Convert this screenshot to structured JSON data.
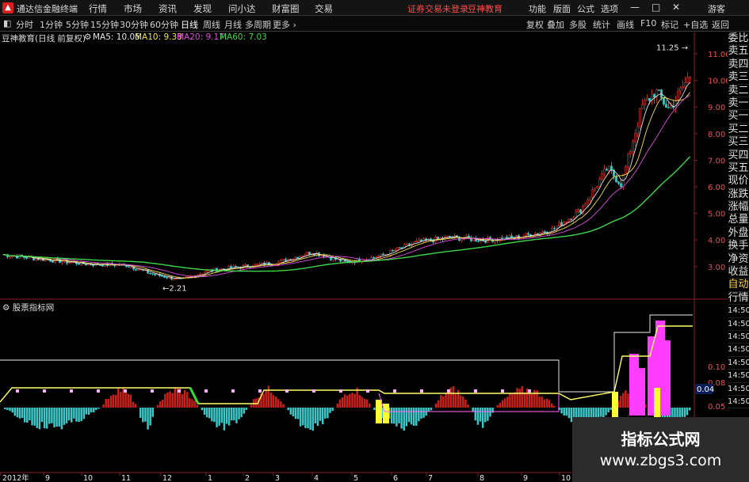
{
  "window": {
    "app_title": "通达信金融终端",
    "menu": [
      "行情",
      "市场",
      "资讯",
      "发现",
      "问小达",
      "财富圈",
      "交易"
    ],
    "notice": "证券交易未登录",
    "broker": "豆神教育",
    "right_menu": [
      "功能",
      "版面",
      "公式",
      "选项"
    ],
    "guest": "游客"
  },
  "toolbar": {
    "periods": [
      "分时",
      "1分钟",
      "5分钟",
      "15分钟",
      "30分钟",
      "60分钟",
      "日线",
      "周线",
      "月线",
      "多周期",
      "更多"
    ],
    "active_period": "日线",
    "right": [
      "复权",
      "叠加",
      "多股",
      "统计",
      "画线",
      "F10",
      "标记",
      "+自选",
      "返回"
    ]
  },
  "main_chart": {
    "stock_label": "豆神教育(日线 前复权)",
    "ma": [
      {
        "label": "MA5: 10.05",
        "color": "#e6e6e6"
      },
      {
        "label": "MA10: 9.33",
        "color": "#f5e04a"
      },
      {
        "label": "MA20: 9.17",
        "color": "#e04ae0"
      },
      {
        "label": "MA60: 7.03",
        "color": "#3dd64a"
      }
    ],
    "price_axis": [
      "11.00",
      "10.00",
      "9.00",
      "8.00",
      "7.00",
      "6.00",
      "5.00",
      "4.00",
      "3.00"
    ],
    "high_marker": "11.25",
    "low_marker": "2.21"
  },
  "sub_chart": {
    "label": "股票指标网",
    "axis": [
      "0.10",
      "0.08",
      "0.05",
      "0.03"
    ],
    "current_value": "0.04"
  },
  "right_panel": {
    "items": [
      "委比",
      "卖五",
      "卖四",
      "卖三",
      "卖二",
      "卖一",
      "买一",
      "买二",
      "买三",
      "买四",
      "买五",
      "现价",
      "涨跌",
      "涨幅",
      "总量",
      "外盘",
      "换手",
      "净资",
      "收益",
      "自动",
      "行情",
      "14:50",
      "14:50",
      "14:50",
      "14:50",
      "14:50",
      "14:50",
      "14:50",
      "14:50"
    ]
  },
  "date_axis": [
    "2012年",
    "9",
    "10",
    "11",
    "12",
    "1",
    "2",
    "3",
    "4",
    "5",
    "6",
    "7",
    "8",
    "9",
    "10"
  ],
  "watermark": {
    "line1": "指标公式网",
    "line2": "www.zbgs3.com"
  },
  "colors": {
    "up": "#e8302a",
    "down": "#3cc8c8",
    "ma60": "#3dd64a",
    "ma20": "#e04ae0",
    "ma10": "#f5e04a",
    "ma5": "#e6e6e6",
    "magenta_bar": "#ff3cff",
    "yellow_bar": "#ffff33"
  }
}
